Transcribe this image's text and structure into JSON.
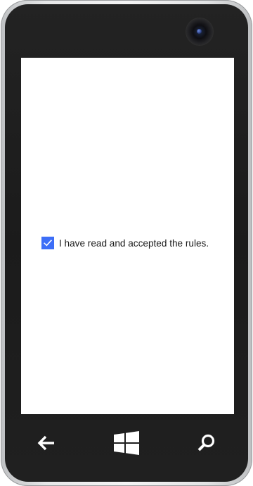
{
  "device": {
    "hardware_buttons": [
      {
        "id": "back",
        "icon": "back-arrow-icon"
      },
      {
        "id": "start",
        "icon": "windows-logo-icon"
      },
      {
        "id": "search",
        "icon": "search-icon"
      }
    ]
  },
  "screen": {
    "background": "#ffffff",
    "checkbox": {
      "checked": true,
      "label": "I have read and accepted the rules.",
      "accent_color": "#3d6ef7"
    }
  }
}
